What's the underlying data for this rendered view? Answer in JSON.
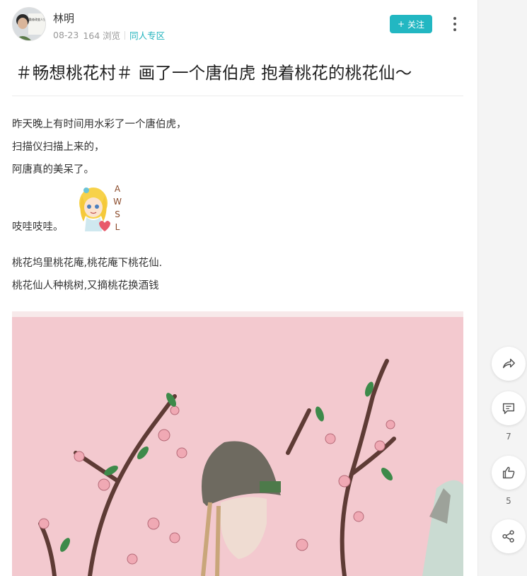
{
  "post": {
    "author": "林明",
    "date": "08-23",
    "views": "164 浏览",
    "category": "同人专区",
    "follow_label": "关注",
    "follow_plus": "+",
    "title": "＃畅想桃花村＃ 画了一个唐伯虎 抱着桃花的桃花仙～",
    "body": {
      "line1": "昨天晚上有时间用水彩了一个唐伯虎，",
      "line2": "扫描仪扫描上来的，",
      "line3": "阿唐真的美呆了。",
      "line4": "吱哇吱哇。",
      "line5": "桃花坞里桃花庵,桃花庵下桃花仙.",
      "line6": "桃花仙人种桃树,又摘桃花换酒钱"
    },
    "sticker_text": "AWSL",
    "avatar_text": "勤奋改变人生"
  },
  "actions": {
    "share_icon": "forward-arrow-icon",
    "comment_icon": "comment-icon",
    "comment_count": "7",
    "like_icon": "thumbs-up-icon",
    "like_count": "5",
    "more_share_icon": "share-nodes-icon"
  },
  "colors": {
    "accent": "#22b7c2",
    "painting_bg": "#f3c9cf",
    "rail_bg": "#f4f4f4"
  }
}
